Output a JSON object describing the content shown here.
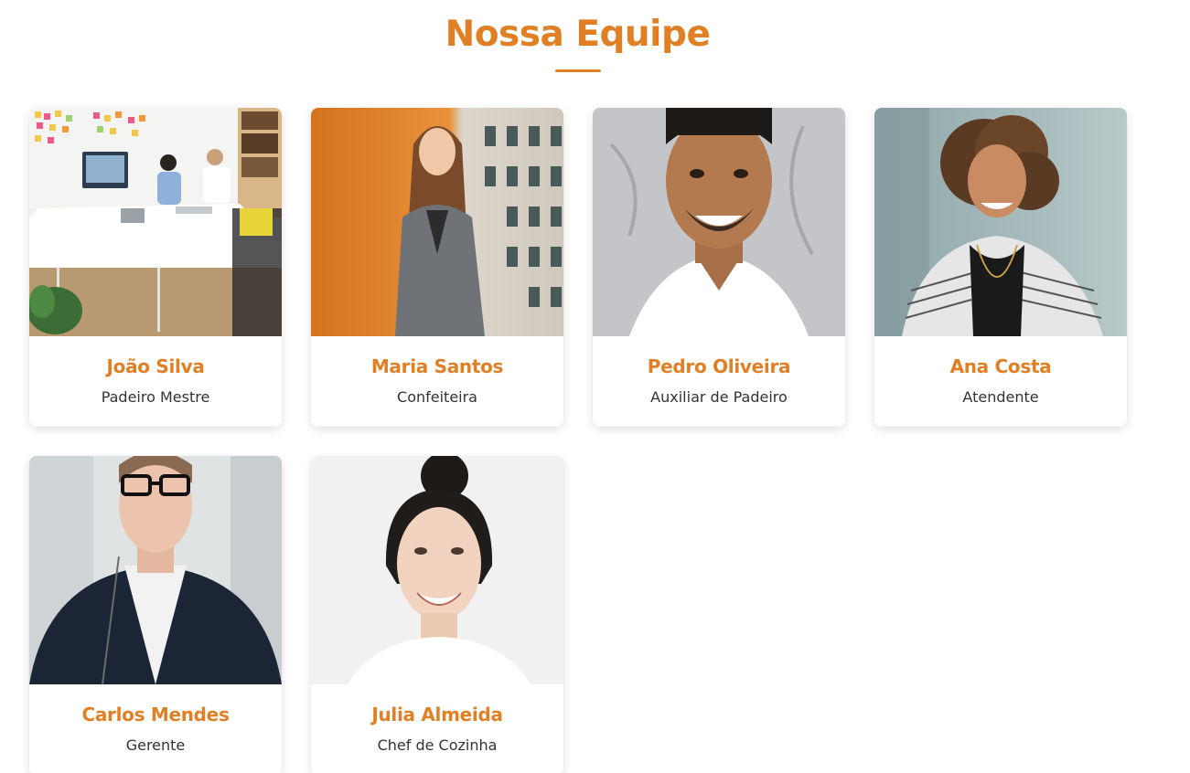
{
  "section": {
    "title": "Nossa Equipe"
  },
  "colors": {
    "accent": "#e07f24",
    "text": "#333333"
  },
  "team": [
    {
      "name": "João Silva",
      "role": "Padeiro Mestre",
      "photo_icon": "team-meeting-photo"
    },
    {
      "name": "Maria Santos",
      "role": "Confeiteira",
      "photo_icon": "woman-portrait-photo"
    },
    {
      "name": "Pedro Oliveira",
      "role": "Auxiliar de Padeiro",
      "photo_icon": "man-portrait-photo"
    },
    {
      "name": "Ana Costa",
      "role": "Atendente",
      "photo_icon": "woman-portrait-photo"
    },
    {
      "name": "Carlos Mendes",
      "role": "Gerente",
      "photo_icon": "man-portrait-photo"
    },
    {
      "name": "Julia Almeida",
      "role": "Chef de Cozinha",
      "photo_icon": "woman-portrait-photo"
    }
  ]
}
